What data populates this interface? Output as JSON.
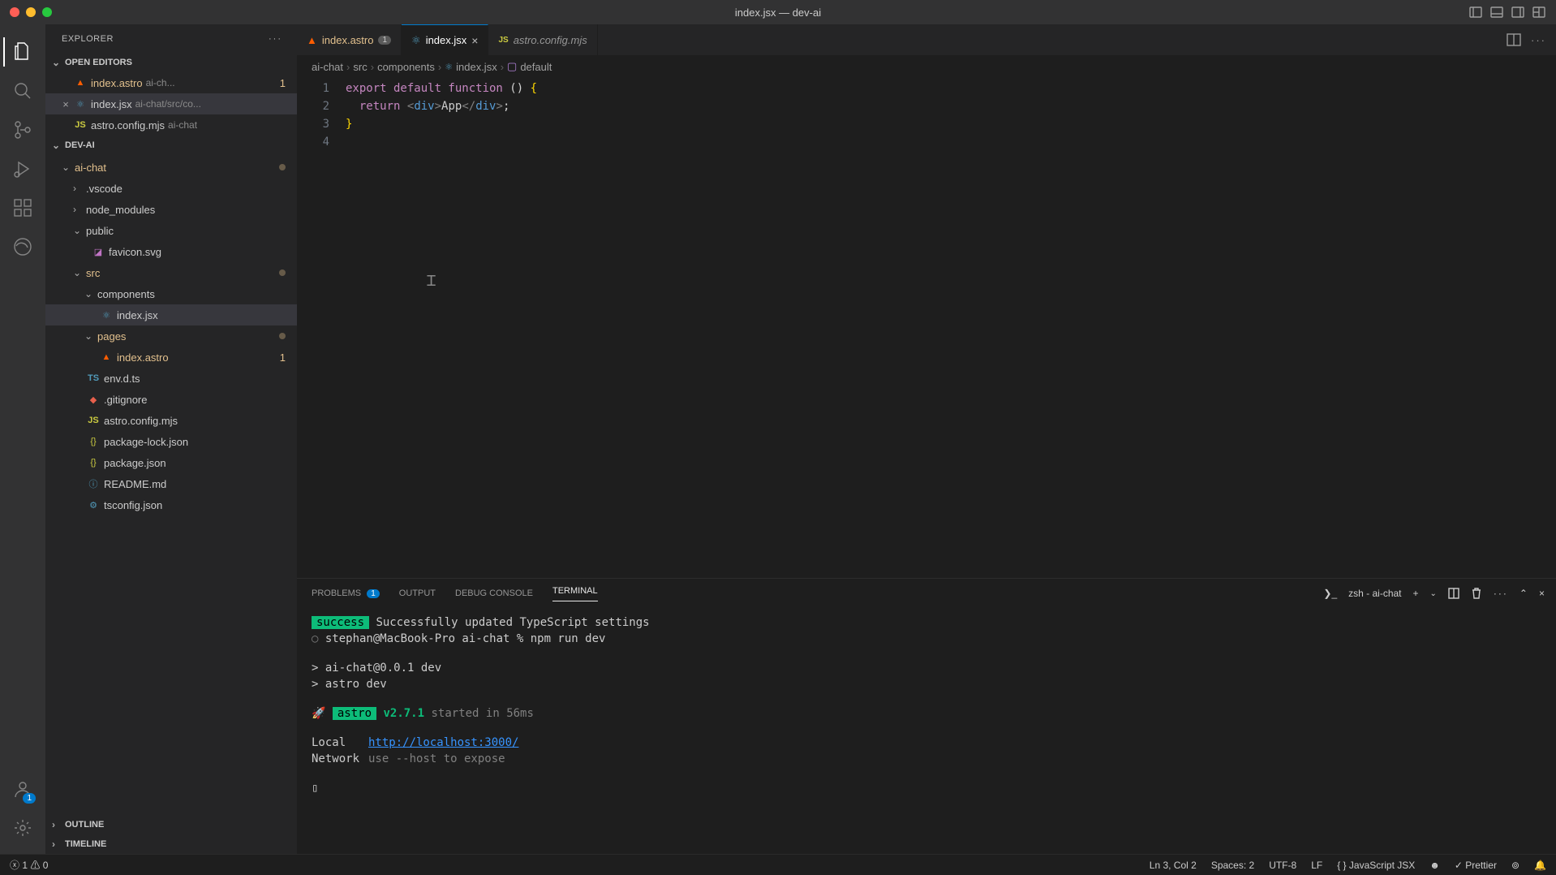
{
  "window": {
    "title": "index.jsx — dev-ai"
  },
  "explorer": {
    "label": "EXPLORER",
    "open_editors": {
      "label": "OPEN EDITORS",
      "items": [
        {
          "name": "index.astro",
          "hint": "ai-ch...",
          "badge": "1"
        },
        {
          "name": "index.jsx",
          "hint": "ai-chat/src/co..."
        },
        {
          "name": "astro.config.mjs",
          "hint": "ai-chat"
        }
      ]
    },
    "workspace_label": "DEV-AI",
    "tree": {
      "root": "ai-chat",
      "vscode": ".vscode",
      "node_modules": "node_modules",
      "public": "public",
      "favicon": "favicon.svg",
      "src": "src",
      "components": "components",
      "index_jsx": "index.jsx",
      "pages": "pages",
      "index_astro": "index.astro",
      "index_astro_badge": "1",
      "env": "env.d.ts",
      "gitignore": ".gitignore",
      "astro_config": "astro.config.mjs",
      "pkg_lock": "package-lock.json",
      "pkg": "package.json",
      "readme": "README.md",
      "tsconfig": "tsconfig.json"
    },
    "outline": "OUTLINE",
    "timeline": "TIMELINE"
  },
  "tabs": [
    {
      "name": "index.astro",
      "badge": "1"
    },
    {
      "name": "index.jsx",
      "active": true
    },
    {
      "name": "astro.config.mjs",
      "italic": true
    }
  ],
  "breadcrumb": [
    "ai-chat",
    "src",
    "components",
    "index.jsx",
    "default"
  ],
  "code": {
    "line1_kw": "export default function ",
    "line1_paren": "() ",
    "line1_brace": "{",
    "line2_kw": "return ",
    "line2_open": "<",
    "line2_tag": "div",
    "line2_close": ">",
    "line2_text": "App",
    "line2_open2": "</",
    "line2_tag2": "div",
    "line2_close2": ">",
    "line2_semi": ";",
    "line3_brace": "}"
  },
  "panel": {
    "problems": {
      "label": "PROBLEMS",
      "count": "1"
    },
    "output": "OUTPUT",
    "debug": "DEBUG CONSOLE",
    "terminal": "TERMINAL",
    "shell": "zsh - ai-chat"
  },
  "terminal": {
    "success_tag": "success",
    "success_msg": " Successfully updated TypeScript settings",
    "prompt": "stephan@MacBook-Pro ai-chat % npm run dev",
    "run1": "> ai-chat@0.0.1 dev",
    "run2": "> astro dev",
    "rocket": "🚀",
    "astro_tag": "astro",
    "astro_ver": " v2.7.1",
    "astro_msg": " started in 56ms",
    "local_label": "Local",
    "local_url": "http://localhost:3000/",
    "network_label": "Network",
    "network_msg": "use --host to expose",
    "cursor": "▯"
  },
  "status": {
    "errors": "1",
    "warnings": "0",
    "line_col": "Ln 3, Col 2",
    "spaces": "Spaces: 2",
    "encoding": "UTF-8",
    "eol": "LF",
    "lang": "JavaScript JSX",
    "prettier": "Prettier"
  }
}
